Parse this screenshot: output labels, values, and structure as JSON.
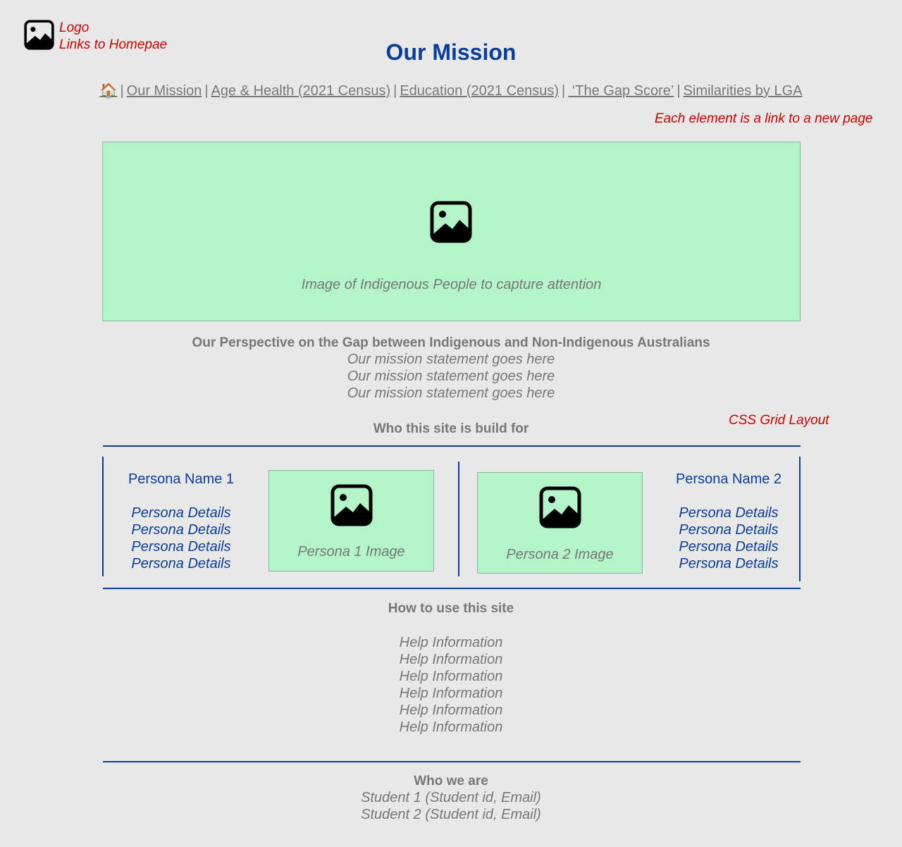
{
  "annotations": {
    "logo_line1": "Logo",
    "logo_line2": "Links to Homepae",
    "nav_note": "Each element is a link to a new page",
    "grid_note": "CSS Grid Layout"
  },
  "logo": {
    "icon": "image-icon"
  },
  "page_title": "Our Mission",
  "nav": {
    "home_glyph": "🏠",
    "separator": "|",
    "items": [
      "Our Mission",
      "Age & Health (2021 Census)",
      "Education (2021 Census)",
      " ‘The Gap Score’",
      "Similarities by LGA"
    ]
  },
  "hero": {
    "icon": "image-icon",
    "caption": "Image of Indigenous People to capture attention"
  },
  "perspective": {
    "heading": "Our Perspective on the Gap between Indigenous and Non-Indigenous Australians",
    "lines": [
      "Our mission statement goes here",
      "Our mission statement goes here",
      "Our mission statement goes here"
    ]
  },
  "audience": {
    "heading": "Who this site is build for",
    "persona1": {
      "name": "Persona Name 1",
      "details": [
        "Persona Details",
        "Persona Details",
        "Persona Details",
        "Persona Details"
      ],
      "image_caption": "Persona 1 Image"
    },
    "persona2": {
      "name": "Persona Name 2",
      "details": [
        "Persona Details",
        "Persona Details",
        "Persona Details",
        "Persona Details"
      ],
      "image_caption": "Persona 2 Image"
    }
  },
  "help": {
    "heading": "How to use this site",
    "lines": [
      "Help Information",
      "Help Information",
      "Help Information",
      "Help Information",
      "Help Information",
      "Help Information"
    ]
  },
  "about": {
    "heading": "Who we are",
    "lines": [
      "Student 1 (Student id, Email)",
      "Student 2 (Student id, Email)"
    ]
  },
  "colors": {
    "background": "#e8e8e8",
    "title_blue": "#0a3d9c",
    "annotation_red": "#d40000",
    "placeholder_green": "#b3f4c9",
    "text_grey": "#777777"
  }
}
